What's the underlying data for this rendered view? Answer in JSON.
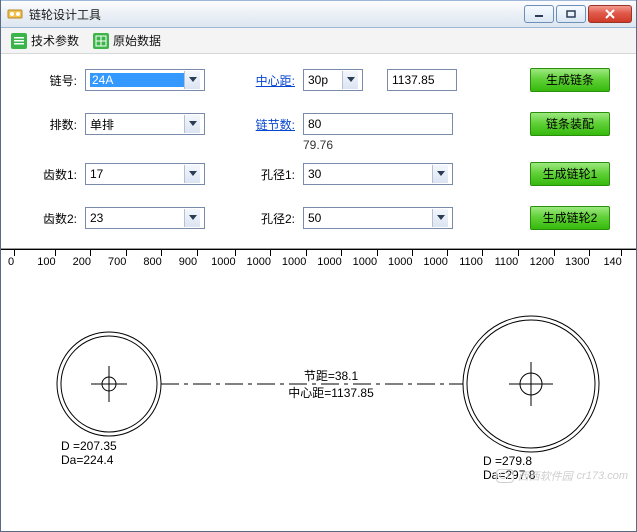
{
  "window": {
    "title": "链轮设计工具"
  },
  "toolbar": {
    "tech_params": "技术参数",
    "raw_data": "原始数据"
  },
  "form": {
    "chain_no_label": "链号:",
    "chain_no_value": "24A",
    "arrangement_label": "排数:",
    "arrangement_value": "单排",
    "teeth1_label": "齿数1:",
    "teeth1_value": "17",
    "teeth2_label": "齿数2:",
    "teeth2_value": "23",
    "center_dist_label": "中心距:",
    "center_dist_combo": "30p",
    "center_dist_text": "1137.85",
    "link_count_label": "链节数:",
    "link_count_value": "80",
    "link_count_calc": "79.76",
    "bore1_label": "孔径1:",
    "bore1_value": "30",
    "bore2_label": "孔径2:",
    "bore2_value": "50"
  },
  "buttons": {
    "gen_chain": "生成链条",
    "chain_assembly": "链条装配",
    "gen_sprocket1": "生成链轮1",
    "gen_sprocket2": "生成链轮2"
  },
  "ruler": {
    "ticks": [
      "0",
      "100",
      "200",
      "700",
      "800",
      "900",
      "1000",
      "1000",
      "1000",
      "1000",
      "1000",
      "1000",
      "1000",
      "1100",
      "1100",
      "1200",
      "1300",
      "140"
    ]
  },
  "drawing": {
    "pitch_label": "节距=38.1",
    "center_label": "中心距=1137.85",
    "sprocket1": {
      "d": "D =207.35",
      "da": "Da=224.4"
    },
    "sprocket2": {
      "d": "D =279.8",
      "da": "Da=297.8"
    }
  },
  "watermark": {
    "site": "西西软件园",
    "url": "cr173.com"
  }
}
